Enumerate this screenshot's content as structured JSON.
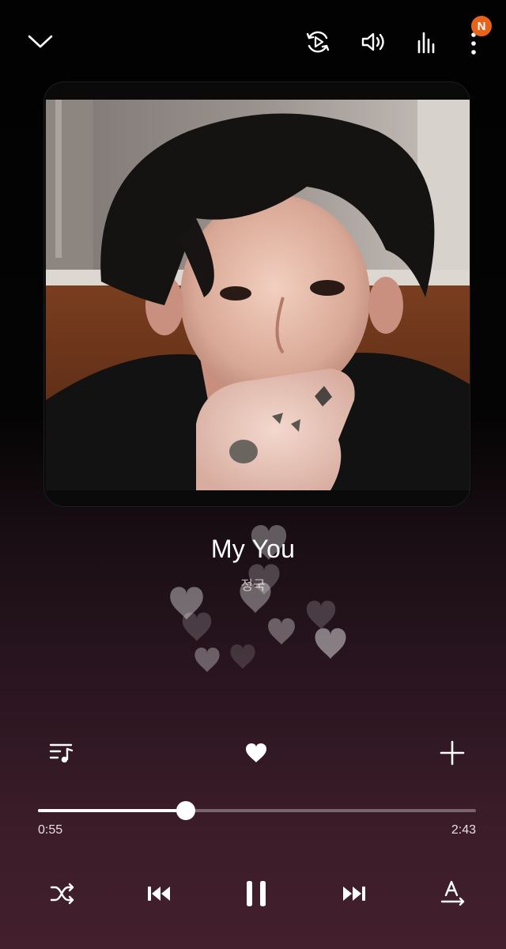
{
  "top_bar": {
    "collapse_icon": "chevron-down-icon",
    "icons": [
      "cast-play-icon",
      "volume-icon",
      "equalizer-icon",
      "more-vertical-icon"
    ],
    "notification_badge": "N",
    "badge_color": "#e8631a"
  },
  "album_art": {
    "description_icon": "album-cover-image"
  },
  "track": {
    "title": "My You",
    "artist": "정국"
  },
  "actions": {
    "queue_icon": "playlist-icon",
    "like_icon": "heart-filled-icon",
    "add_icon": "plus-icon"
  },
  "progress": {
    "elapsed": "0:55",
    "total": "2:43",
    "fraction": 0.3374
  },
  "controls": {
    "icons": [
      "shuffle-icon",
      "previous-icon",
      "pause-icon",
      "next-icon",
      "lyrics-icon"
    ]
  },
  "colors": {
    "background_top": "#020202",
    "background_bottom": "#431f2d",
    "accent": "#ffffff"
  }
}
